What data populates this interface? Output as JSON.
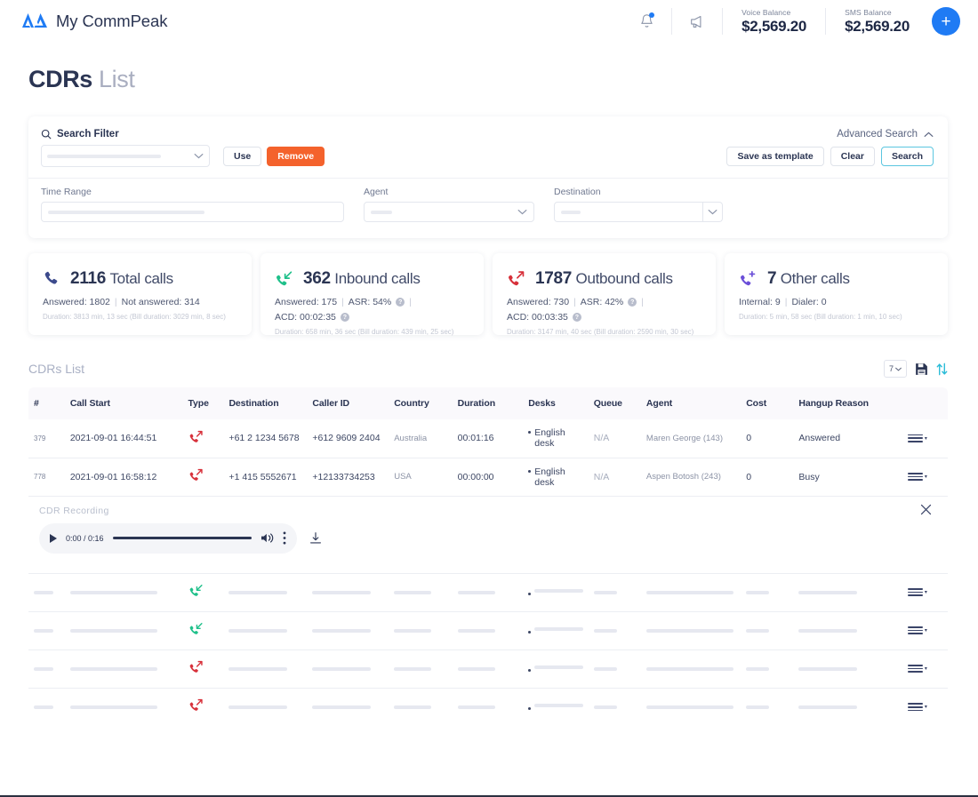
{
  "header": {
    "brand": "My CommPeak",
    "notifications_icon": "bell-icon",
    "announcements_icon": "megaphone-icon",
    "voice_balance_label": "Voice Balance",
    "voice_balance_value": "$2,569.20",
    "sms_balance_label": "SMS Balance",
    "sms_balance_value": "$2,569.20",
    "add_button_label": "+"
  },
  "page": {
    "title_bold": "CDRs",
    "title_light": "List"
  },
  "search_filter": {
    "title": "Search Filter",
    "advanced_search_label": "Advanced Search",
    "template_select_value": "",
    "use_label": "Use",
    "remove_label": "Remove",
    "save_as_template_label": "Save as template",
    "clear_label": "Clear",
    "search_label": "Search",
    "fields": [
      {
        "label": "Time Range",
        "value": ""
      },
      {
        "label": "Agent",
        "value": ""
      },
      {
        "label": "Destination",
        "value": ""
      }
    ]
  },
  "stats": [
    {
      "icon": "phone-icon",
      "icon_color": "#3c4a8c",
      "count": "2116",
      "label": "Total calls",
      "metrics": [
        {
          "text": "Answered: 1802",
          "help": false
        },
        {
          "text": "Not answered: 314",
          "help": false
        }
      ],
      "duration": "Duration: 3813 min, 13 sec (Bill duration: 3029 min, 8 sec)"
    },
    {
      "icon": "inbound-call-icon",
      "icon_color": "#1fc08a",
      "count": "362",
      "label": "Inbound calls",
      "metrics": [
        {
          "text": "Answered: 175",
          "help": false
        },
        {
          "text": "ASR: 54%",
          "help": true
        },
        {
          "text": "ACD: 00:02:35",
          "help": true
        }
      ],
      "duration": "Duration: 658 min, 36 sec (Bill duration: 439 min, 25 sec)"
    },
    {
      "icon": "outbound-call-icon",
      "icon_color": "#d7303a",
      "count": "1787",
      "label": "Outbound calls",
      "metrics": [
        {
          "text": "Answered: 730",
          "help": false
        },
        {
          "text": "ASR: 42%",
          "help": true
        },
        {
          "text": "ACD: 00:03:35",
          "help": true
        }
      ],
      "duration": "Duration: 3147 min, 40 sec (Bill duration: 2590 min, 30 sec)"
    },
    {
      "icon": "other-call-icon",
      "icon_color": "#6b4fd8",
      "count": "7",
      "label": "Other calls",
      "metrics": [
        {
          "text": "Internal: 9",
          "help": false
        },
        {
          "text": "Dialer: 0",
          "help": false
        }
      ],
      "duration": "Duration: 5 min, 58 sec (Bill duration: 1 min, 10 sec)"
    }
  ],
  "table": {
    "section_title": "CDRs List",
    "per_page_value": "7",
    "save_icon": "floppy-disk-icon",
    "sort_icon": "sort-arrows-icon",
    "columns": [
      "#",
      "Call Start",
      "Type",
      "Destination",
      "Caller ID",
      "Country",
      "Duration",
      "Desks",
      "Queue",
      "Agent",
      "Cost",
      "Hangup Reason",
      ""
    ],
    "rows": [
      {
        "index": "379",
        "call_start": "2021-09-01 16:44:51",
        "type": "outbound",
        "destination": "+61 2 1234 5678",
        "caller_id": "+612 9609 2404",
        "country": "Australia",
        "duration": "00:01:16",
        "desk": "English desk",
        "queue": "N/A",
        "agent": "Maren George (143)",
        "cost": "0",
        "hangup_reason": "Answered"
      },
      {
        "index": "778",
        "call_start": "2021-09-01 16:58:12",
        "type": "outbound",
        "destination": "+1 415 5552671",
        "caller_id": "+12133734253",
        "country": "USA",
        "duration": "00:00:00",
        "desk": "English desk",
        "queue": "N/A",
        "agent": "Aspen Botosh (243)",
        "cost": "0",
        "hangup_reason": "Busy"
      }
    ],
    "loading_rows": [
      {
        "type": "inbound"
      },
      {
        "type": "inbound"
      },
      {
        "type": "outbound"
      },
      {
        "type": "outbound"
      }
    ]
  },
  "recording": {
    "title": "CDR Recording",
    "current_time": "0:00",
    "total_time": "0:16",
    "time_display": "0:00 / 0:16",
    "play_icon": "play-icon",
    "volume_icon": "volume-icon",
    "more_icon": "more-vertical-icon",
    "download_icon": "download-icon",
    "close_icon": "close-icon"
  },
  "colors": {
    "brand_blue": "#1f7bf4",
    "accent_orange": "#f4622c",
    "inbound_green": "#1fc08a",
    "outbound_red": "#d7303a",
    "search_border": "#5bc6e0",
    "text_dark": "#2b3553"
  }
}
